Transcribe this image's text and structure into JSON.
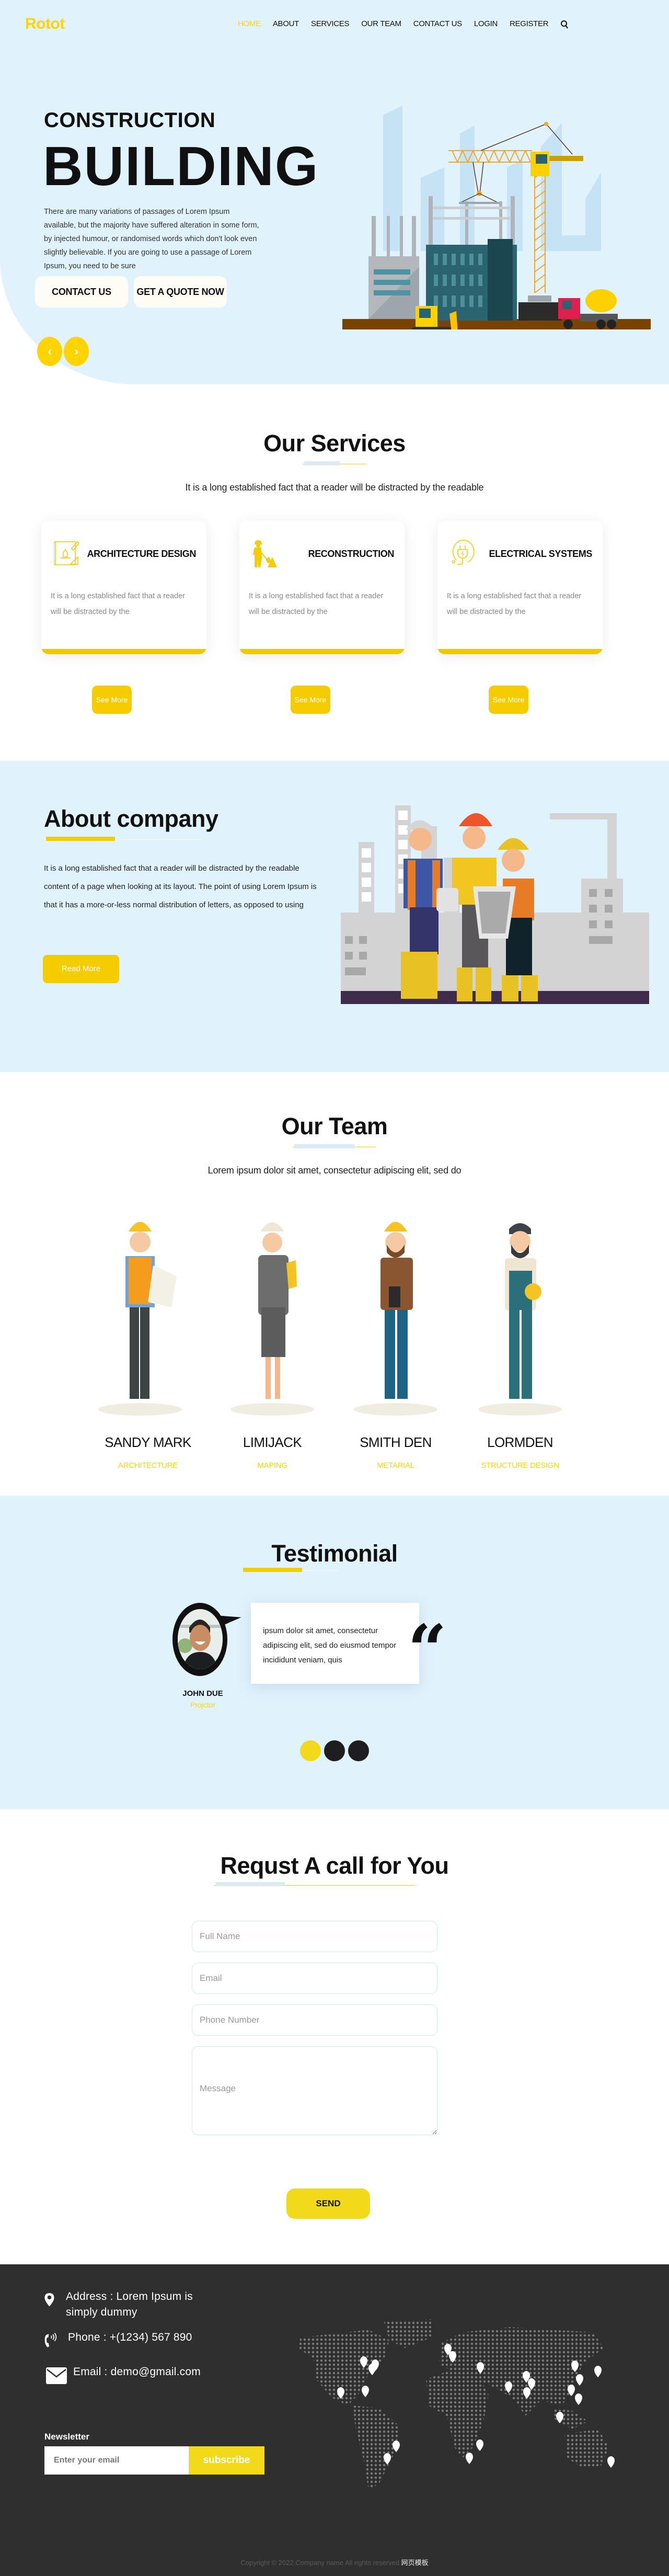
{
  "header": {
    "logo": "Rotot",
    "nav": [
      {
        "label": "HOME",
        "active": true
      },
      {
        "label": "ABOUT",
        "active": false
      },
      {
        "label": "SERVICES",
        "active": false
      },
      {
        "label": "OUR TEAM",
        "active": false
      },
      {
        "label": "CONTACT US",
        "active": false
      },
      {
        "label": "LOGIN",
        "active": false
      },
      {
        "label": "REGISTER",
        "active": false
      }
    ],
    "search_icon": "search-icon"
  },
  "hero": {
    "subtitle": "CONSTRUCTION",
    "title": "BUILDING",
    "text": "There are many variations of passages of Lorem Ipsum available, but the majority have suffered alteration in some form, by injected humour, or randomised words which don't look even slightly believable. If you are going to use a passage of Lorem Ipsum, you need to be sure",
    "contact_button": "CONTACT US",
    "quote_button": "GET A QUOTE NOW",
    "prev_arrow": "‹",
    "next_arrow": "›"
  },
  "services": {
    "title": "Our Services",
    "subtitle": "It is a long established fact that a reader will be distracted by the readable",
    "cards": [
      {
        "title": "ARCHITECTURE DESIGN",
        "text": "It is a long established fact that a reader will be distracted by the",
        "icon": "blueprint-icon",
        "button": "See More"
      },
      {
        "title": "RECONSTRUCTION",
        "text": "It is a long established fact that a reader will be distracted by the",
        "icon": "worker-shovel-icon",
        "button": "See More"
      },
      {
        "title": "ELECTRICAL SYSTEMS",
        "text": "It is a long established fact that a reader will be distracted by the",
        "icon": "plug-icon",
        "button": "See More"
      }
    ]
  },
  "about": {
    "title": "About company",
    "text": "It is a long established fact that a reader will be distracted by the readable content of a page when looking at its layout. The point of using Lorem Ipsum is that it has a more-or-less normal distribution of letters, as opposed to using",
    "button": "Read More"
  },
  "team": {
    "title": "Our Team",
    "subtitle": "Lorem ipsum dolor sit amet, consectetur adipiscing elit, sed do",
    "members": [
      {
        "name": "SANDY MARK",
        "role": "ARCHITECTURE"
      },
      {
        "name": "LIMIJACK",
        "role": "MAPING"
      },
      {
        "name": "SMITH DEN",
        "role": "METARIAL"
      },
      {
        "name": "LORMDEN",
        "role": "STRUCTURE DESIGN"
      }
    ]
  },
  "testimonial": {
    "title": "Testimonial",
    "quote": "ipsum dolor sit amet, consectetur adipiscing elit, sed do eiusmod tempor incididunt veniam, quis",
    "quote_mark": "“",
    "name": "JOHN DUE",
    "role": "Projctor",
    "slides": 3,
    "active_slide": 1
  },
  "request": {
    "title": "Requst A call for You",
    "fields": {
      "name_placeholder": "Full Name",
      "email_placeholder": "Email",
      "phone_placeholder": "Phone Number",
      "message_placeholder": "Message"
    },
    "send_button": "SEND"
  },
  "footer": {
    "address": "Address : Lorem Ipsum is simply dummy",
    "phone": "Phone : +(1234) 567 890",
    "email": "Email : demo@gmail.com",
    "newsletter_label": "Newsletter",
    "newsletter_placeholder": "Enter your email",
    "subscribe_button": "subscribe",
    "copyright": "Copyright © 2022.Company name All rights reserved.",
    "copyright_link": "网页模板"
  },
  "colors": {
    "accent": "#ffd400",
    "button_yellow": "#f5cc00",
    "hero_bg": "#e0f2fc",
    "footer_bg": "#2f2f2f"
  }
}
